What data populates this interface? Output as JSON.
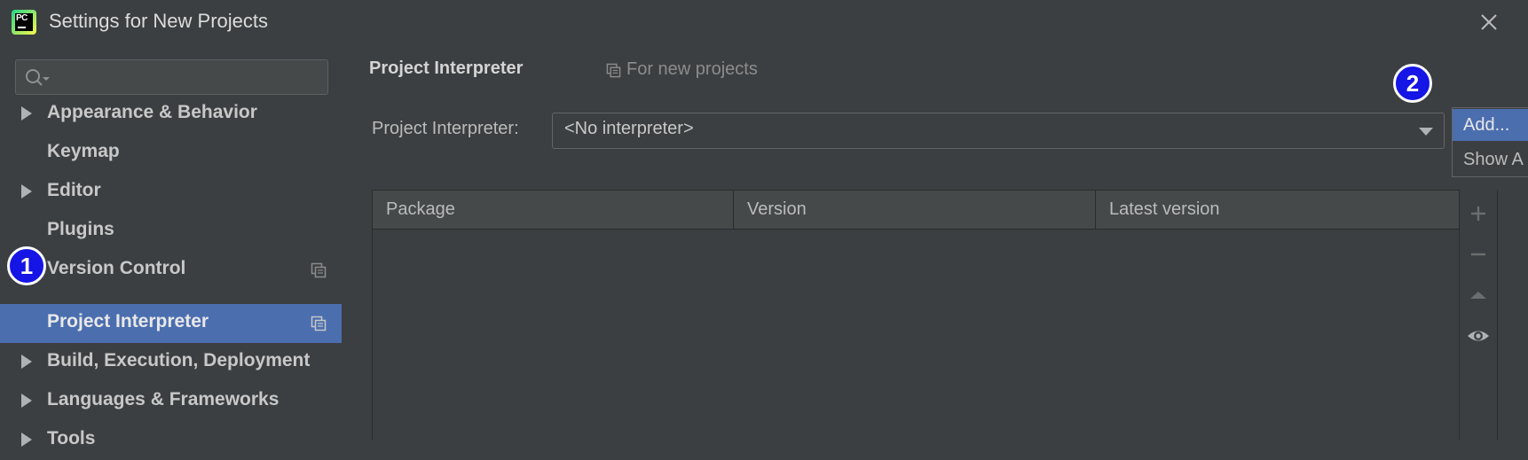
{
  "window": {
    "title": "Settings for New Projects",
    "app_icon": "pycharm-icon",
    "app_icon_text": "PC"
  },
  "sidebar": {
    "search": {
      "value": "",
      "placeholder": ""
    },
    "items": [
      {
        "label": "Appearance & Behavior",
        "expandable": true
      },
      {
        "label": "Keymap",
        "expandable": false
      },
      {
        "label": "Editor",
        "expandable": true
      },
      {
        "label": "Plugins",
        "expandable": false
      },
      {
        "label": "Version Control",
        "expandable": true,
        "project_scoped": true
      },
      {
        "label": "Project Interpreter",
        "expandable": false,
        "project_scoped": true,
        "selected": true
      },
      {
        "label": "Build, Execution, Deployment",
        "expandable": true
      },
      {
        "label": "Languages & Frameworks",
        "expandable": true
      },
      {
        "label": "Tools",
        "expandable": true
      }
    ]
  },
  "main": {
    "title": "Project Interpreter",
    "scope_text": "For new projects",
    "interpreter_label": "Project Interpreter:",
    "interpreter_value": "<No interpreter>",
    "dropdown_menu": {
      "options": [
        "Add...",
        "Show A"
      ]
    },
    "table": {
      "columns": [
        "Package",
        "Version",
        "Latest version"
      ],
      "rows": []
    },
    "toolbar": [
      "plus-icon",
      "minus-icon",
      "up-arrow-icon",
      "eye-icon"
    ]
  },
  "annotations": {
    "badge_1": "1",
    "badge_2": "2"
  },
  "colors": {
    "background": "#3c3f41",
    "selection": "#4b6eaf",
    "badge": "#1515e6",
    "text": "#bbbbbb"
  }
}
